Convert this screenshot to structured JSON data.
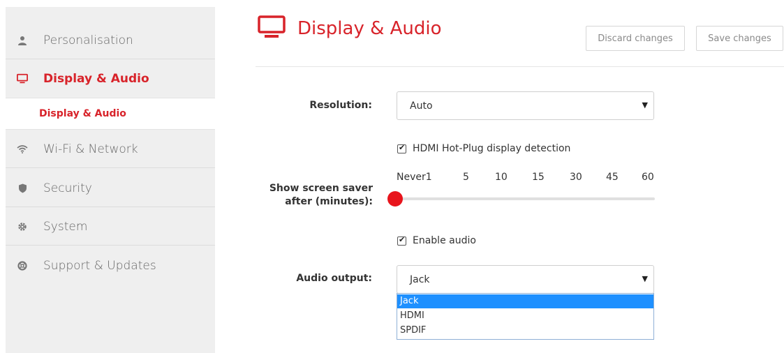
{
  "sidebar": {
    "items": [
      {
        "label": "Personalisation",
        "icon": "user-icon"
      },
      {
        "label": "Display & Audio",
        "icon": "monitor-icon",
        "active": true
      },
      {
        "label": "Wi-Fi & Network",
        "icon": "wifi-icon"
      },
      {
        "label": "Security",
        "icon": "shield-icon"
      },
      {
        "label": "System",
        "icon": "gear-icon"
      },
      {
        "label": "Support & Updates",
        "icon": "lifebuoy-icon"
      }
    ],
    "subitem": {
      "label": "Display & Audio"
    }
  },
  "header": {
    "title": "Display & Audio",
    "discard_label": "Discard changes",
    "save_label": "Save changes"
  },
  "form": {
    "resolution": {
      "label": "Resolution:",
      "value": "Auto"
    },
    "hdmi_hotplug": {
      "label": "HDMI Hot-Plug display detection",
      "checked": true
    },
    "screensaver": {
      "label_line1": "Show screen saver",
      "label_line2": "after (minutes):",
      "ticks": [
        "Never1",
        "5",
        "10",
        "15",
        "30",
        "45",
        "60"
      ],
      "value": "Never"
    },
    "enable_audio": {
      "label": "Enable audio",
      "checked": true
    },
    "audio_output": {
      "label": "Audio output:",
      "value": "Jack",
      "options": [
        "Jack",
        "HDMI",
        "SPDIF"
      ],
      "highlighted": "Jack"
    }
  },
  "colors": {
    "accent": "#d8232a",
    "slider_thumb": "#e8141c",
    "selection": "#1e90ff"
  }
}
